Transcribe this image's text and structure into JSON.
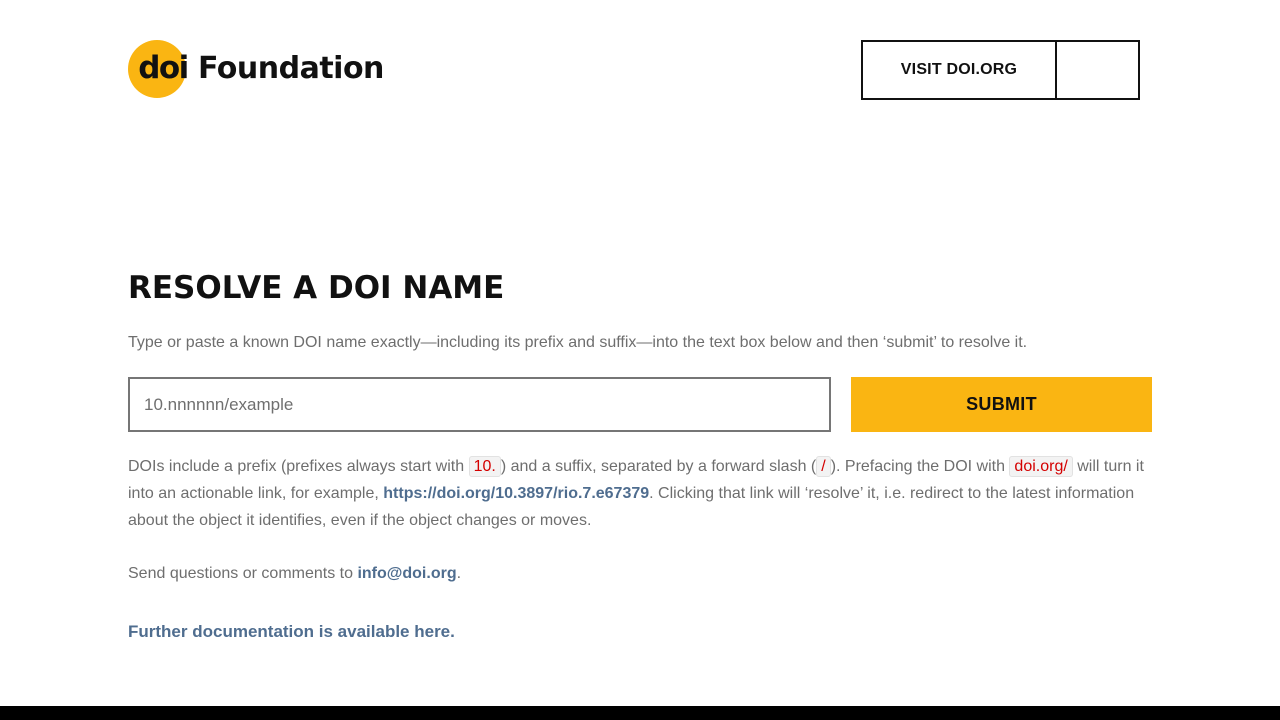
{
  "header": {
    "logo_mark": "doi",
    "logo_text": "Foundation",
    "visit_label": "VISIT DOI.ORG"
  },
  "main": {
    "title": "RESOLVE A DOI NAME",
    "intro": "Type or paste a known DOI name exactly—including its prefix and suffix—into the text box below and then ‘submit’ to resolve it.",
    "input_placeholder": "10.nnnnnn/example",
    "input_value": "",
    "submit_label": "SUBMIT"
  },
  "explanation": {
    "part1": "DOIs include a prefix (prefixes always start with ",
    "prefix_token": "10.",
    "part2": ") and a suffix, separated by a forward slash (",
    "slash_token": "/",
    "part3": "). Prefacing the DOI with ",
    "doiorg_token": "doi.org/",
    "part4": " will turn it into an actionable link, for example, ",
    "example_link": "https://doi.org/10.3897/rio.7.e67379",
    "part5": ". Clicking that link will ‘resolve’ it, i.e. redirect to the latest information about the object it identifies, even if the object changes or moves."
  },
  "contact": {
    "text": "Send questions or comments to ",
    "email": "info@doi.org",
    "period": "."
  },
  "docs_link": "Further documentation is available here.",
  "colors": {
    "accent": "#fab512",
    "link": "#4f6d8f",
    "code": "#d40000",
    "footer": "#000000"
  }
}
